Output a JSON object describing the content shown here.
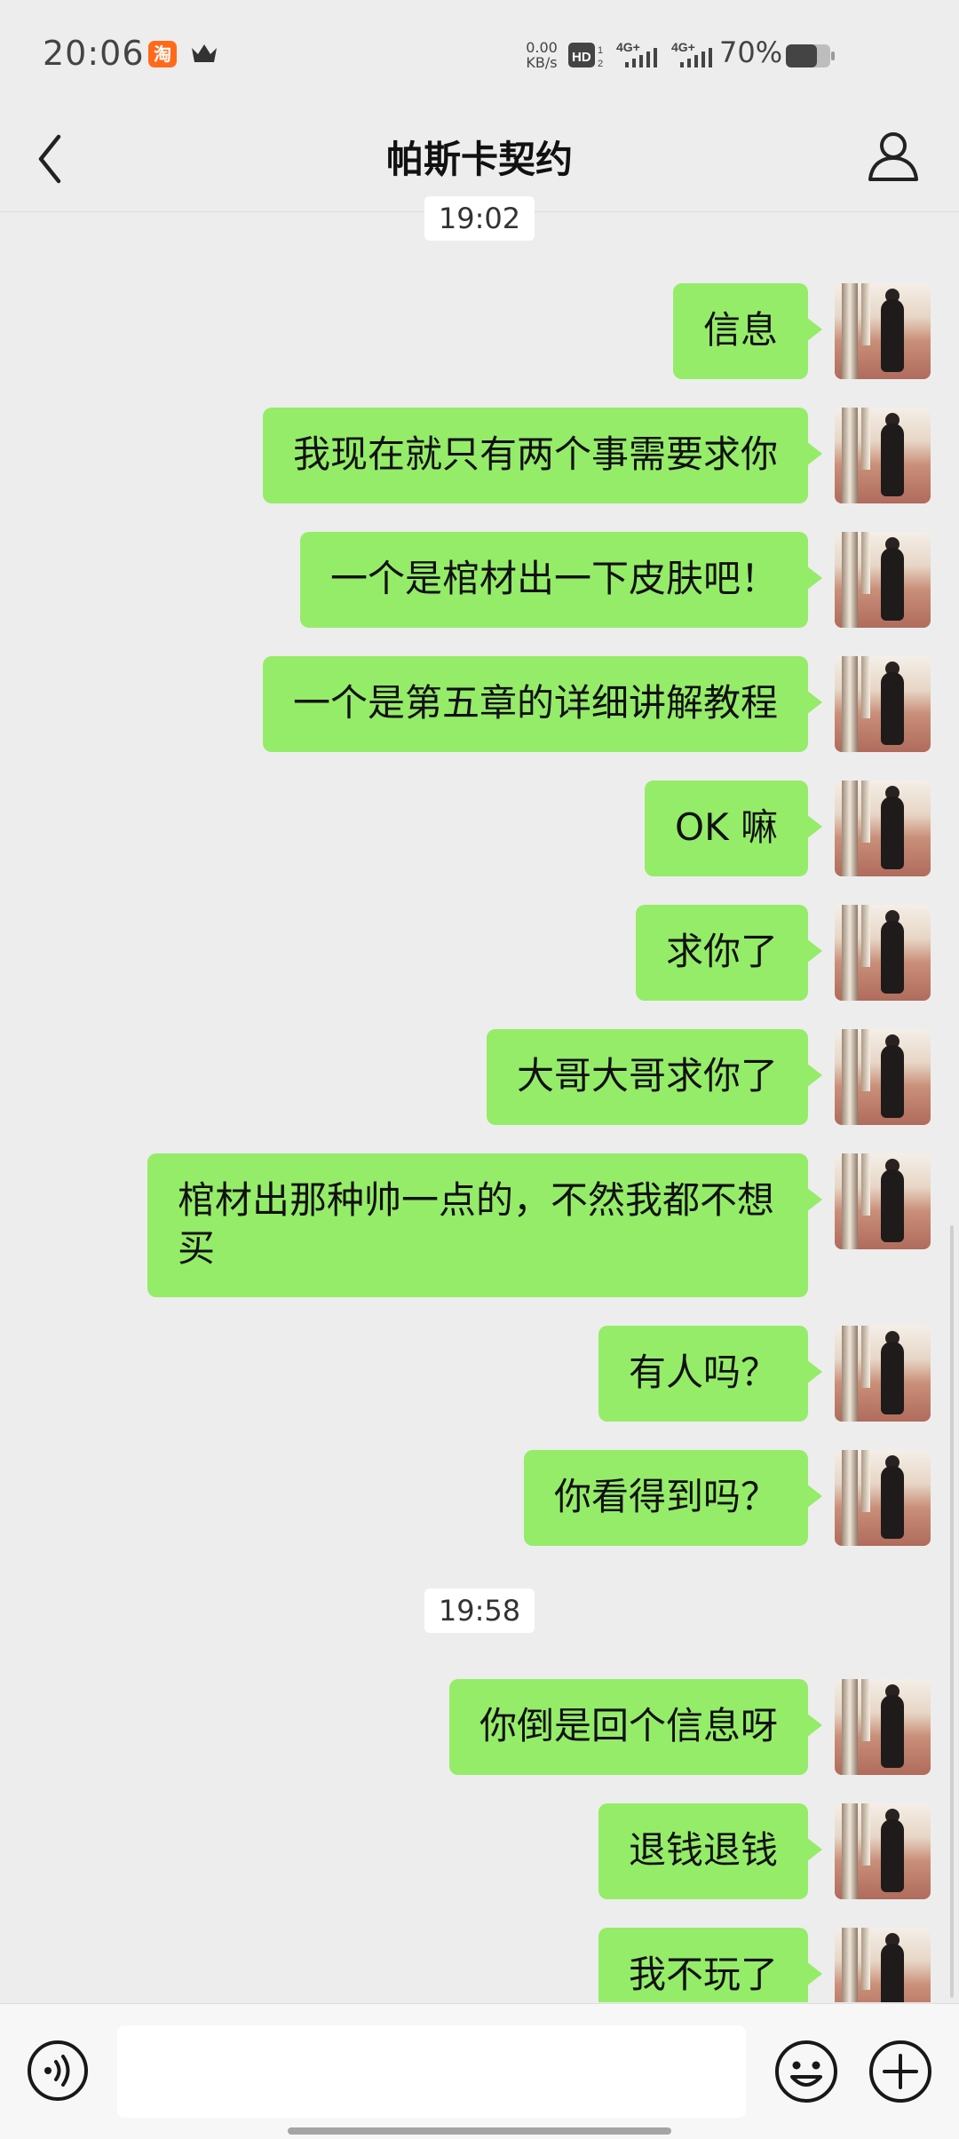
{
  "status_bar": {
    "time": "20:06",
    "net_speed_value": "0.00",
    "net_speed_unit": "KB/s",
    "network_1": "4G+",
    "network_2": "4G+",
    "battery": "70%",
    "battery_level": 0.7,
    "icons": [
      "taobao-icon",
      "crown-icon",
      "hd-icon",
      "signal-icon",
      "signal-icon",
      "battery-icon"
    ]
  },
  "nav": {
    "title": "帕斯卡契约",
    "left_icon": "back-icon",
    "right_icon": "profile-icon"
  },
  "chat": {
    "timestamps": [
      "19:02",
      "19:58"
    ],
    "messages": [
      {
        "text": "信息",
        "from": "me"
      },
      {
        "text": "我现在就只有两个事需要求你",
        "from": "me"
      },
      {
        "text": "一个是棺材出一下皮肤吧！",
        "from": "me"
      },
      {
        "text": "一个是第五章的详细讲解教程",
        "from": "me"
      },
      {
        "text": "OK 嘛",
        "from": "me"
      },
      {
        "text": "求你了",
        "from": "me"
      },
      {
        "text": "大哥大哥求你了",
        "from": "me"
      },
      {
        "text": "棺材出那种帅一点的，不然我都不想买",
        "from": "me"
      },
      {
        "text": "有人吗？",
        "from": "me"
      },
      {
        "text": "你看得到吗？",
        "from": "me"
      },
      {
        "text": "你倒是回个信息呀",
        "from": "me"
      },
      {
        "text": "退钱退钱",
        "from": "me"
      },
      {
        "text": "我不玩了",
        "from": "me"
      }
    ],
    "bubble_color": "#95ec69",
    "background_color": "#ededed"
  },
  "input_bar": {
    "input_value": "",
    "icons": [
      "voice-icon",
      "emoji-icon",
      "plus-icon"
    ]
  }
}
